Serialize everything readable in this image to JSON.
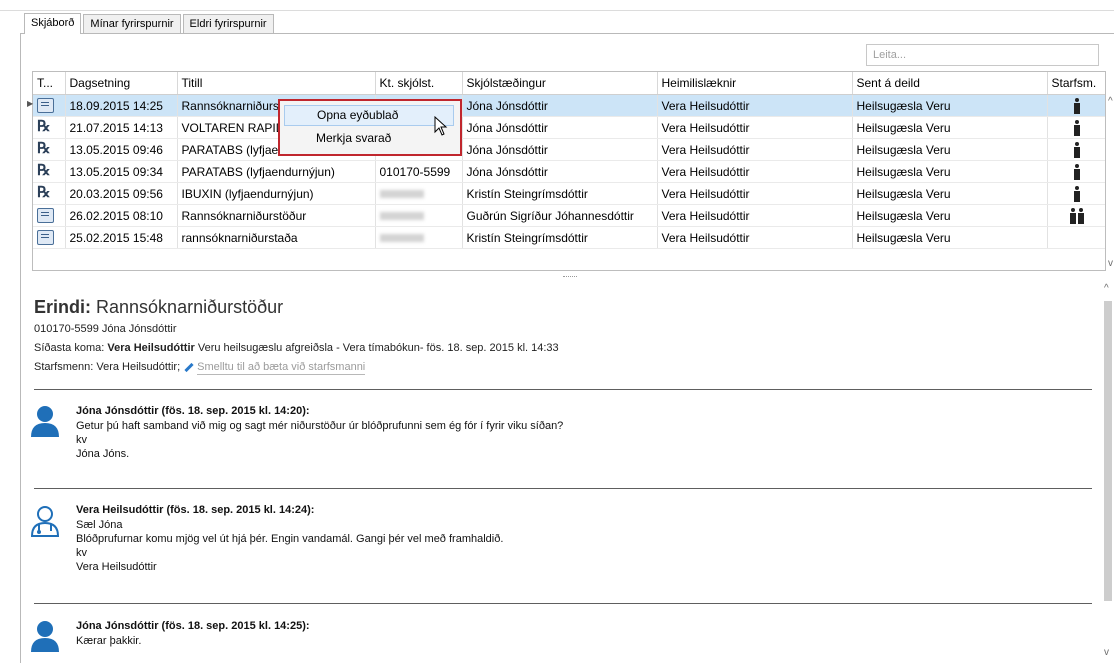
{
  "tabs": [
    "Skjáborð",
    "Mínar fyrirspurnir",
    "Eldri fyrirspurnir"
  ],
  "search": {
    "placeholder": "Leita..."
  },
  "grid": {
    "columns": [
      "T...",
      "Dagsetning",
      "Titill",
      "Kt. skjólst.",
      "Skjólstæðingur",
      "Heimilislæknir",
      "Sent á deild",
      "Starfsm."
    ],
    "rows": [
      {
        "icon": "message-icon",
        "date": "18.09.2015 14:25",
        "title": "Rannsóknarniðurs",
        "kt": "",
        "client": "Jóna Jónsdóttir",
        "doctor": "Vera Heilsudóttir",
        "dept": "Heilsugæsla Veru",
        "staff": "single-person-icon",
        "selected": true
      },
      {
        "icon": "rx-icon",
        "date": "21.07.2015 14:13",
        "title": "VOLTAREN RAPID",
        "kt": "",
        "client": "Jóna Jónsdóttir",
        "doctor": "Vera Heilsudóttir",
        "dept": "Heilsugæsla Veru",
        "staff": "single-person-icon"
      },
      {
        "icon": "rx-icon",
        "date": "13.05.2015 09:46",
        "title": "PARATABS (lyfjae",
        "kt": "",
        "client": "Jóna Jónsdóttir",
        "doctor": "Vera Heilsudóttir",
        "dept": "Heilsugæsla Veru",
        "staff": "single-person-icon"
      },
      {
        "icon": "rx-icon",
        "date": "13.05.2015 09:34",
        "title": "PARATABS (lyfjaendurnýjun)",
        "kt": "010170-5599",
        "client": "Jóna Jónsdóttir",
        "doctor": "Vera Heilsudóttir",
        "dept": "Heilsugæsla Veru",
        "staff": "single-person-icon"
      },
      {
        "icon": "rx-icon",
        "date": "20.03.2015 09:56",
        "title": "IBUXIN (lyfjaendurnýjun)",
        "kt": "",
        "client": "Kristín Steingrímsdóttir",
        "doctor": "Vera Heilsudóttir",
        "dept": "Heilsugæsla Veru",
        "staff": "single-person-icon"
      },
      {
        "icon": "message-icon",
        "date": "26.02.2015 08:10",
        "title": "Rannsóknarniðurstöður",
        "kt": "",
        "client": "Guðrún Sigríður Jóhannesdóttir",
        "doctor": "Vera Heilsudóttir",
        "dept": "Heilsugæsla Veru",
        "staff": "two-persons-icon"
      },
      {
        "icon": "message-icon",
        "date": "25.02.2015 15:48",
        "title": "rannsóknarniðurstaða",
        "kt": "",
        "client": "Kristín Steingrímsdóttir",
        "doctor": "Vera Heilsudóttir",
        "dept": "Heilsugæsla Veru",
        "staff": ""
      }
    ]
  },
  "context_menu": {
    "items": [
      "Opna eyðublað",
      "Merkja svarað"
    ]
  },
  "detail": {
    "title_prefix": "Erindi:",
    "title": "Rannsóknarniðurstöður",
    "patient": "010170-5599 Jóna Jónsdóttir",
    "last_visit_label": "Síðasta koma:",
    "last_visit_name": "Vera Heilsudóttir",
    "last_visit_rest": "Veru heilsugæslu afgreiðsla - Vera tímabókun- fös. 18. sep. 2015 kl. 14:33",
    "staff_label": "Starfsmenn: Vera Heilsudóttir;",
    "add_staff": "Smelltu til að bæta við starfsmanni",
    "messages": [
      {
        "who": "Jóna Jónsdóttir (fös. 18. sep. 2015 kl. 14:20):",
        "lines": [
          "Getur þú haft samband við mig og sagt mér niðurstöður úr blóðprufunni sem ég fór í fyrir viku síðan?",
          "kv",
          "Jóna Jóns."
        ],
        "avatar": "patient-avatar-icon"
      },
      {
        "who": "Vera Heilsudóttir (fös. 18. sep. 2015 kl. 14:24):",
        "lines": [
          "Sæl Jóna",
          "Blóðprufurnar komu mjög vel út hjá þér.  Engin vandamál.  Gangi þér vel með framhaldið.",
          "kv",
          "Vera Heilsudóttir"
        ],
        "avatar": "doctor-avatar-icon"
      },
      {
        "who": "Jóna Jónsdóttir (fös. 18. sep. 2015 kl. 14:25):",
        "lines": [
          "Kærar þakkir."
        ],
        "avatar": "patient-avatar-icon"
      }
    ]
  },
  "colors": {
    "selected_row": "#cce4f7",
    "context_border": "#c0262d",
    "avatar_blue": "#1f6fb8"
  }
}
